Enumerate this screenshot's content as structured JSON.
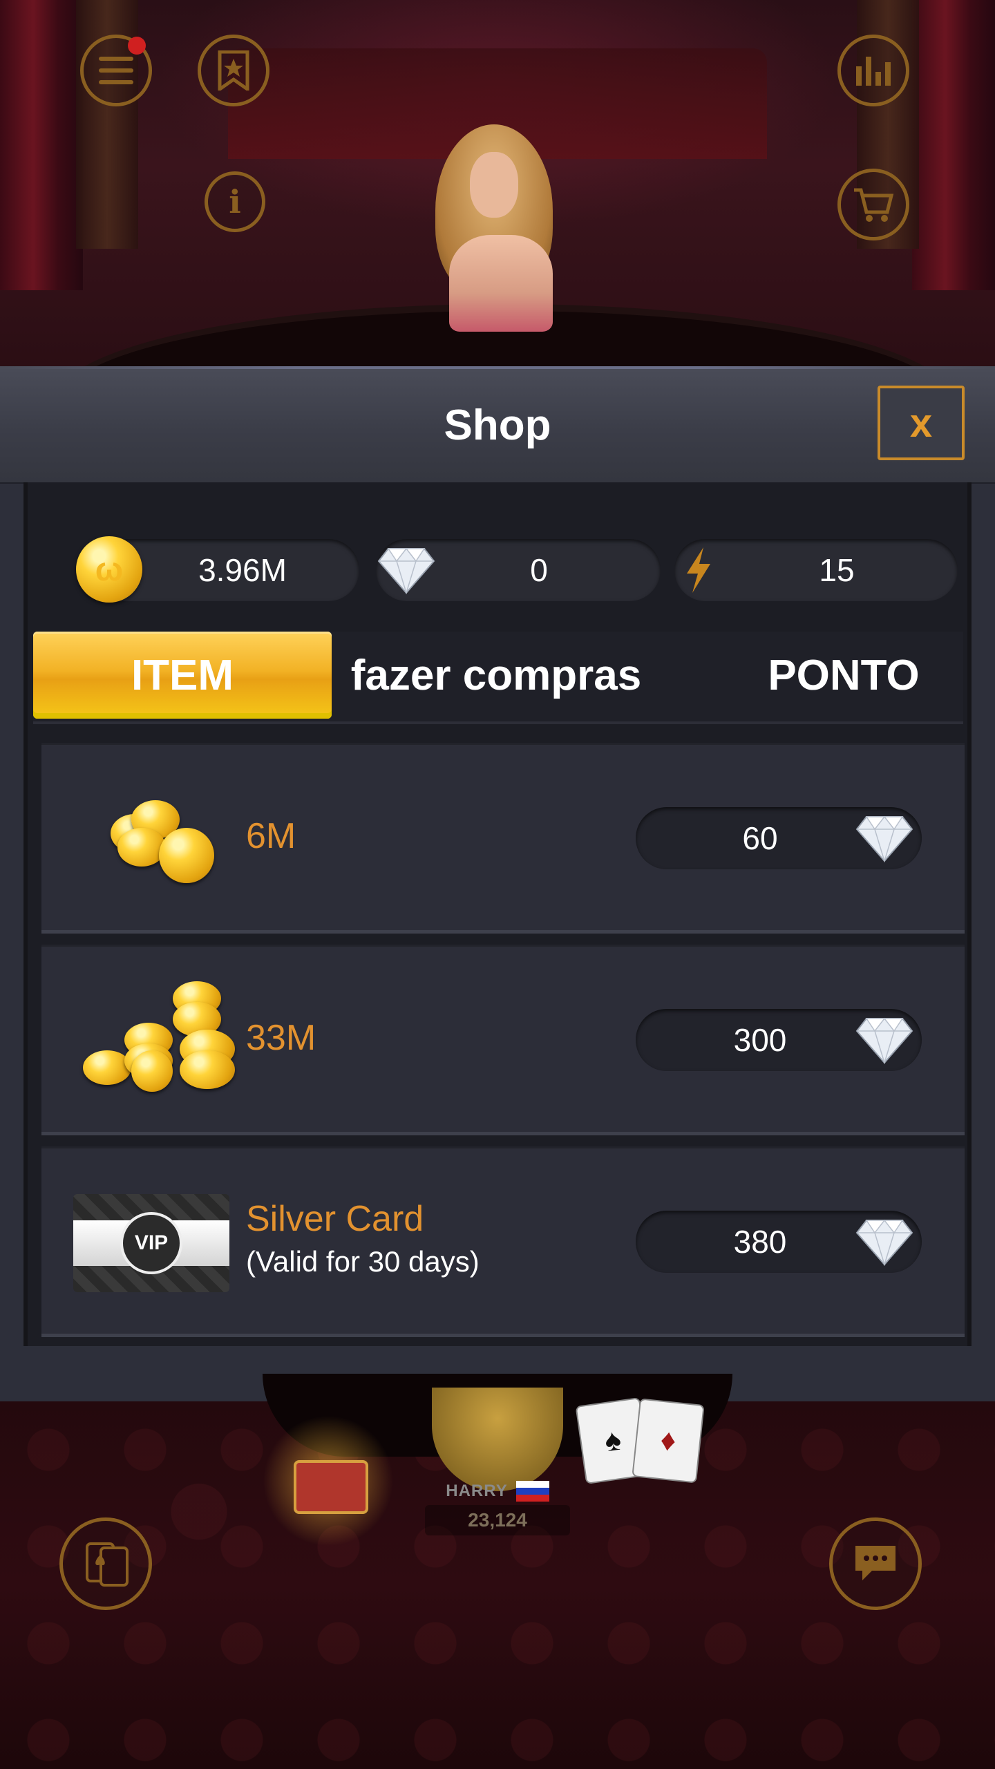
{
  "shop": {
    "title": "Shop",
    "close_label": "x",
    "currencies": {
      "coins": "3.96M",
      "diamonds": "0",
      "energy": "15"
    },
    "tabs": [
      {
        "label": "ITEM",
        "active": true
      },
      {
        "label": "fazer compras",
        "active": false
      },
      {
        "label": "PONTO",
        "active": false
      }
    ],
    "items": [
      {
        "label": "6M",
        "sublabel": "",
        "price": "60",
        "icon": "coin-stack-small-icon"
      },
      {
        "label": "33M",
        "sublabel": "",
        "price": "300",
        "icon": "coin-pile-large-icon"
      },
      {
        "label": "Silver Card",
        "sublabel": "(Valid for 30 days)",
        "price": "380",
        "icon": "vip-card-icon"
      }
    ]
  },
  "vip_card_text": "VIP",
  "player": {
    "name": "HARRY",
    "chips": "23,124"
  },
  "colors": {
    "accent_gold": "#e3922f",
    "tab_active": "#f2b225",
    "panel_bg": "#2d2f3a"
  }
}
